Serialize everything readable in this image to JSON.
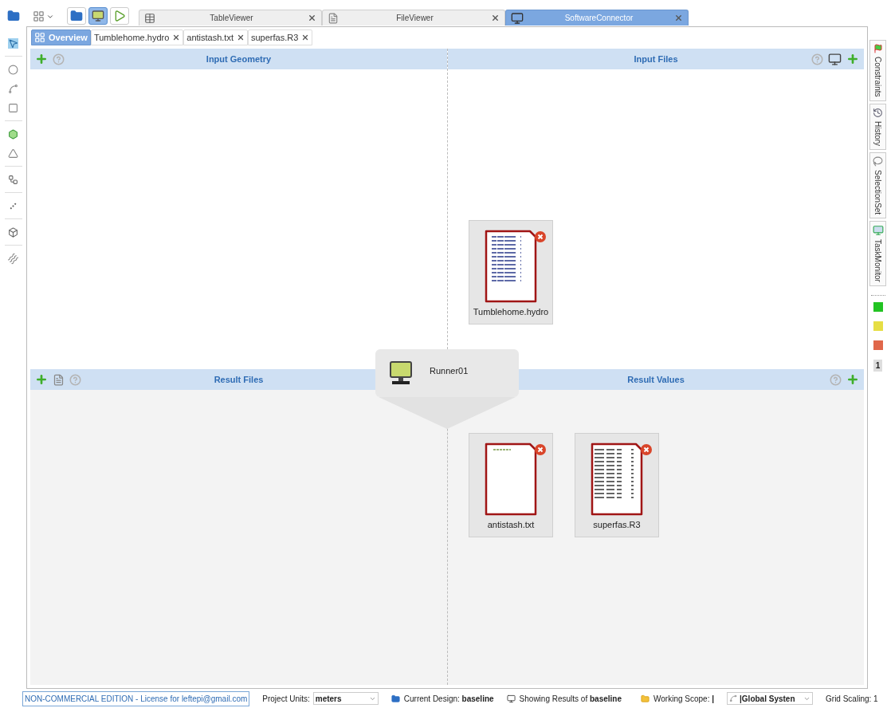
{
  "view_buttons": [
    {
      "kind": "folder",
      "selected": false
    },
    {
      "kind": "monitor",
      "selected": true
    },
    {
      "kind": "play",
      "selected": false
    }
  ],
  "editor_tabs": [
    {
      "label": "TableViewer",
      "kind": "table",
      "selected": false
    },
    {
      "label": "FileViewer",
      "kind": "file",
      "selected": false
    },
    {
      "label": "SoftwareConnector",
      "kind": "monitor",
      "selected": true
    }
  ],
  "inner_tabs": [
    {
      "label": "Overview",
      "closable": false,
      "selected": true
    },
    {
      "label": "Tumblehome.hydro",
      "closable": true,
      "selected": false
    },
    {
      "label": "antistash.txt",
      "closable": true,
      "selected": false
    },
    {
      "label": "superfas.R3",
      "closable": true,
      "selected": false
    }
  ],
  "sections": [
    {
      "title": "Input Geometry",
      "kind": "geometry"
    },
    {
      "title": "Input Files",
      "kind": "input_files",
      "files": [
        {
          "name": "Tumblehome.hydro",
          "kind": "hydro"
        }
      ]
    },
    {
      "title": "Result Files",
      "kind": "result_files"
    },
    {
      "title": "Result Values",
      "kind": "result_values",
      "files": [
        {
          "name": "antistash.txt",
          "kind": "txt"
        },
        {
          "name": "superfas.R3",
          "kind": "table"
        }
      ]
    }
  ],
  "runner": {
    "name": "Runner01"
  },
  "side_tabs": [
    {
      "label": "Constraints",
      "kind": "constraints"
    },
    {
      "label": "History",
      "kind": "history"
    },
    {
      "label": "SelectionSet",
      "kind": "selection"
    },
    {
      "label": "TaskMonitor",
      "kind": "monitor"
    }
  ],
  "status_lights": [
    {
      "color": "#22c322"
    },
    {
      "color": "#e6de44"
    },
    {
      "color": "#e0674a"
    }
  ],
  "task_count": "1",
  "status_bar": {
    "license": "NON-COMMERCIAL EDITION - License for leftepi@gmail.com",
    "units_label": "Project Units:",
    "units_value": "meters",
    "design_label": "Current Design:",
    "design_value": "baseline",
    "results_label": "Showing Results of",
    "results_value": "baseline",
    "scope_label": "Working Scope:",
    "scope_value": "|",
    "coord_value": "|Global Systen",
    "grid_scaling": "Grid Scaling: 1"
  }
}
